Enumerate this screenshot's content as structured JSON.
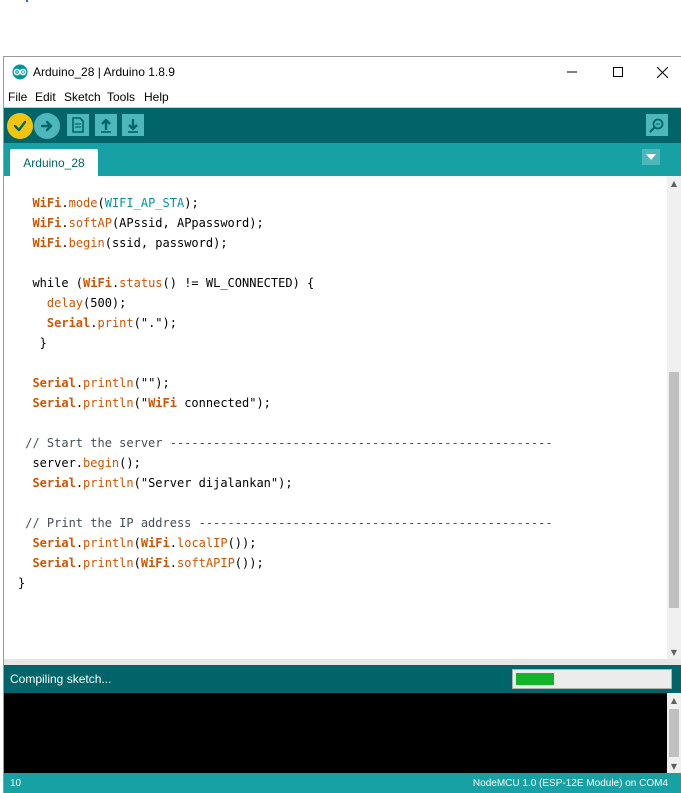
{
  "window": {
    "title": "Arduino_28 | Arduino 1.8.9",
    "controls": {
      "minimize": "minimize-icon",
      "maximize": "maximize-icon",
      "close": "close-icon"
    }
  },
  "menu": {
    "items": [
      "File",
      "Edit",
      "Sketch",
      "Tools",
      "Help"
    ]
  },
  "toolbar": {
    "buttons": [
      "verify-icon",
      "upload-icon",
      "new-icon",
      "open-icon",
      "save-icon",
      "serial-monitor-icon"
    ]
  },
  "tabs": {
    "active": "Arduino_28"
  },
  "code": {
    "lines": [
      {
        "text": "  WiFi.mode(WIFI_AP_STA);"
      },
      {
        "text": "  WiFi.softAP(APssid, APpassword);"
      },
      {
        "text": "  WiFi.begin(ssid, password);"
      },
      {
        "text": ""
      },
      {
        "text": "  while (WiFi.status() != WL_CONNECTED) {"
      },
      {
        "text": "    delay(500);"
      },
      {
        "text": "    Serial.print(\".\");"
      },
      {
        "text": "   }"
      },
      {
        "text": ""
      },
      {
        "text": "  Serial.println(\"\");"
      },
      {
        "text": "  Serial.println(\"WiFi connected\");"
      },
      {
        "text": ""
      },
      {
        "text": " // Start the server -----------------------------------------------------"
      },
      {
        "text": "  server.begin();"
      },
      {
        "text": "  Serial.println(\"Server dijalankan\");"
      },
      {
        "text": ""
      },
      {
        "text": " // Print the IP address -------------------------------------------------"
      },
      {
        "text": "  Serial.println(WiFi.localIP());"
      },
      {
        "text": "  Serial.println(WiFi.softAPIP());"
      },
      {
        "text": "}"
      }
    ]
  },
  "status": {
    "message": "Compiling sketch...",
    "progress": 0.25
  },
  "footer": {
    "line": "10",
    "board": "NodeMCU 1.0 (ESP-12E Module) on COM4"
  },
  "colors": {
    "teal_dark": "#006468",
    "teal": "#17a1a5",
    "accent": "#f1c40f",
    "keyword": "#d35400",
    "constant": "#00979c"
  }
}
